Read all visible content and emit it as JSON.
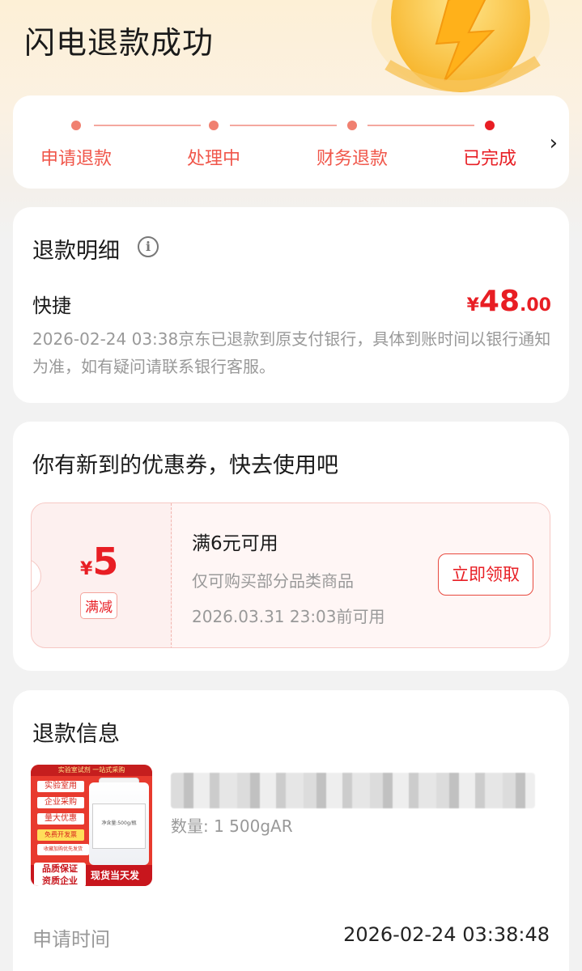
{
  "page_title": "闪电退款成功",
  "progress": {
    "steps": [
      "申请退款",
      "处理中",
      "财务退款",
      "已完成"
    ],
    "current": 4
  },
  "refund_detail": {
    "title": "退款明细",
    "method": "快捷",
    "amount_symbol": "¥",
    "amount_int": "48",
    "amount_dec": ".00",
    "desc": "2026-02-24 03:38京东已退款到原支付银行，具体到账时间以银行通知为准，如有疑问请联系银行客服。"
  },
  "coupon_section": {
    "title": "你有新到的优惠券，快去使用吧",
    "symbol": "¥",
    "value": "5",
    "tag": "满减",
    "condition": "满6元可用",
    "scope": "仅可购买部分品类商品",
    "expiry": "2026.03.31 23:03前可用",
    "button": "立即领取"
  },
  "refund_info": {
    "title": "退款信息",
    "product": {
      "thumb_top": "实验室试剂 一站式采购",
      "thumb_tags": [
        "实验室用",
        "企业采购",
        "量大优惠",
        "免费开发票",
        "收藏加购优先发货"
      ],
      "thumb_badge": [
        "品质保证",
        "资质企业"
      ],
      "thumb_slogan": "现货当天发",
      "thumb_label": "净含量:500g/瓶",
      "quantity": "数量: 1  500gAR"
    },
    "apply_time_label": "申请时间",
    "apply_time_value": "2026-02-24 03:38:48"
  },
  "colors": {
    "accent": "#e81e24",
    "step_dot": "#f08070",
    "muted_text": "#999999"
  }
}
